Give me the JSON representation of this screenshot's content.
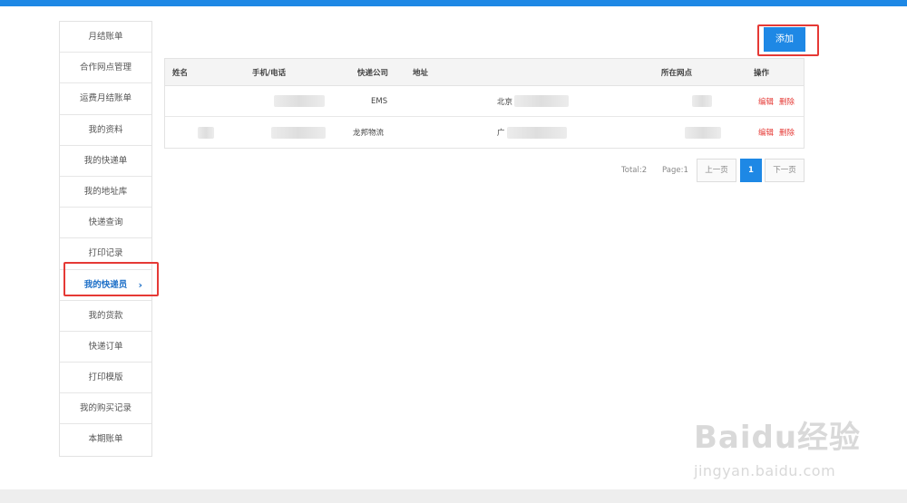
{
  "sidebar": {
    "items": [
      {
        "label": "月结账单"
      },
      {
        "label": "合作网点管理"
      },
      {
        "label": "运费月结账单"
      },
      {
        "label": "我的资料"
      },
      {
        "label": "我的快递单"
      },
      {
        "label": "我的地址库"
      },
      {
        "label": "快递查询"
      },
      {
        "label": "打印记录"
      },
      {
        "label": "我的快递员",
        "active": true,
        "icon": "chevron-right-icon"
      },
      {
        "label": "我的货款"
      },
      {
        "label": "快递订单"
      },
      {
        "label": "打印模版"
      },
      {
        "label": "我的购买记录"
      },
      {
        "label": "本期账单"
      }
    ]
  },
  "toolbar": {
    "add_label": "添加"
  },
  "table": {
    "headers": {
      "name": "姓名",
      "phone": "手机/电话",
      "company": "快递公司",
      "address": "地址",
      "outlet": "所在网点",
      "ops": "操作"
    },
    "rows": [
      {
        "name": "",
        "phone": "",
        "company": "EMS",
        "address": "北京",
        "outlet": "",
        "edit": "编辑",
        "delete": "删除"
      },
      {
        "name": "",
        "phone": "",
        "company": "龙邦物流",
        "address": "广",
        "outlet": "",
        "edit": "编辑",
        "delete": "删除"
      }
    ]
  },
  "pagination": {
    "total": "Total:2",
    "page": "Page:1",
    "prev": "上一页",
    "current": "1",
    "next": "下一页"
  },
  "watermark": {
    "brand": "Baidu经验",
    "url": "jingyan.baidu.com"
  },
  "colors": {
    "accent": "#1e88e5",
    "danger": "#e53935",
    "highlight": "#e53935"
  }
}
